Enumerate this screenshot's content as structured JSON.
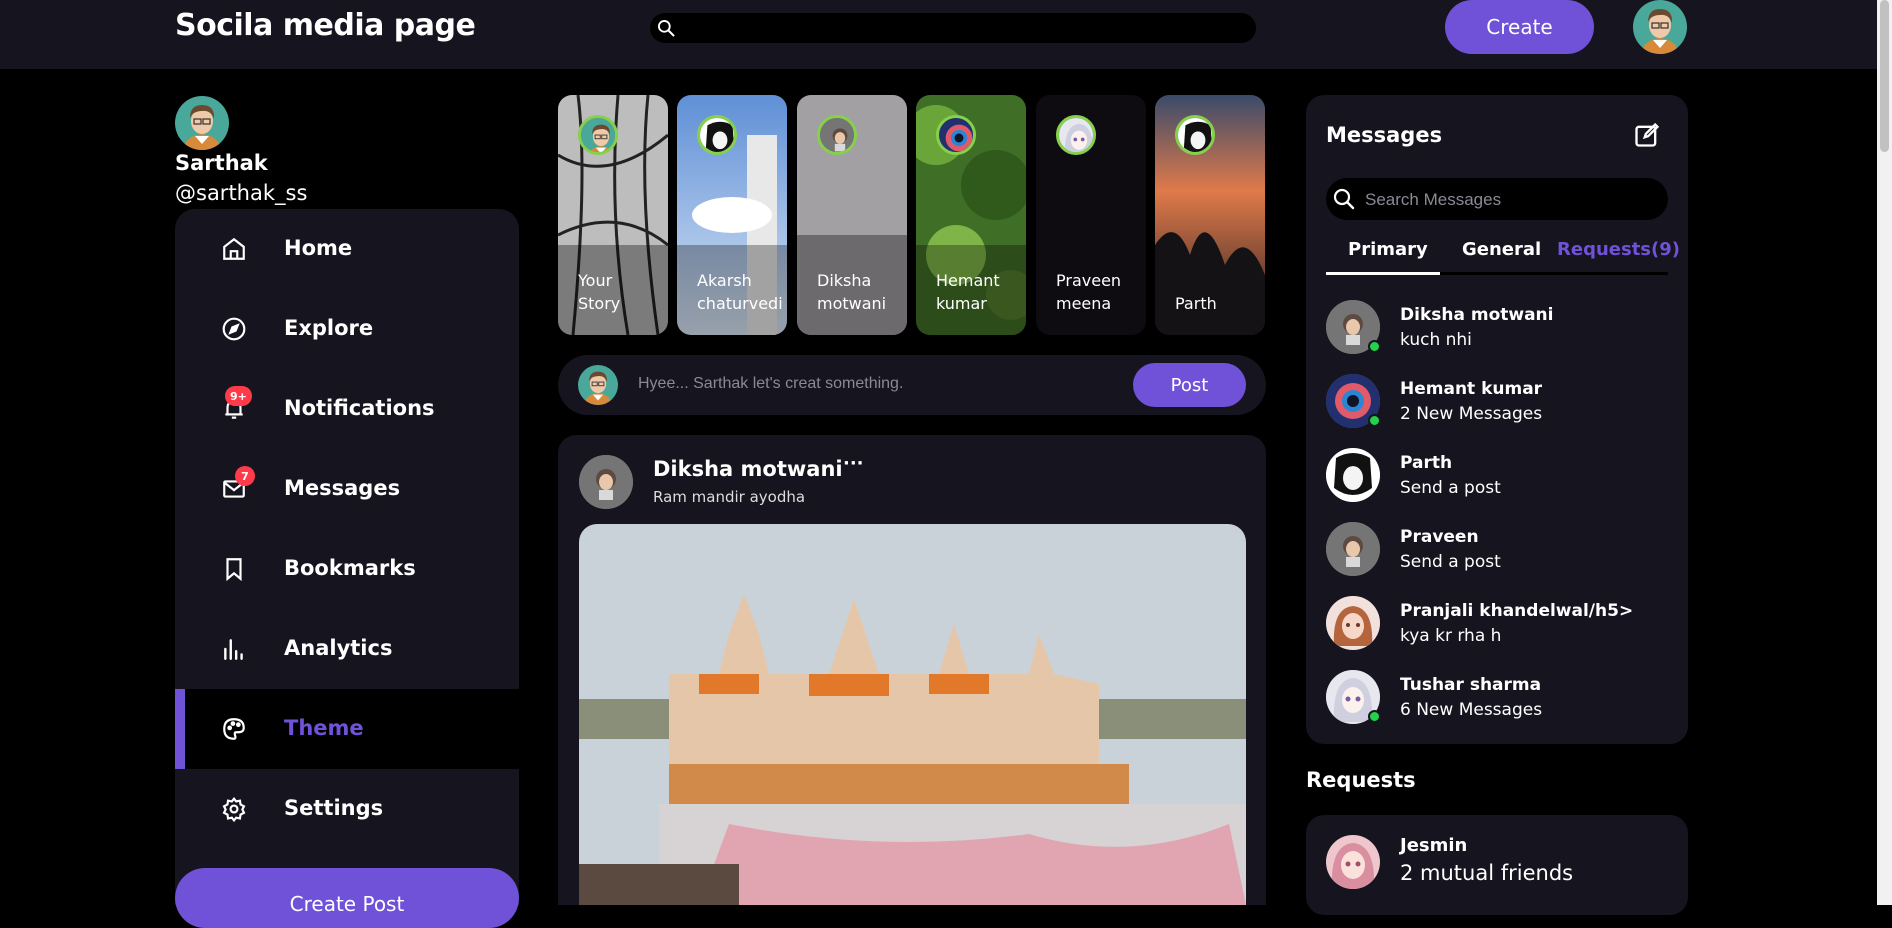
{
  "app": {
    "title": "Socila media page",
    "create_label": "Create"
  },
  "search": {
    "placeholder": ""
  },
  "profile": {
    "name": "Sarthak",
    "handle": "@sarthak_ss"
  },
  "sidebar": {
    "items": [
      {
        "label": "Home",
        "icon": "home-icon"
      },
      {
        "label": "Explore",
        "icon": "compass-icon"
      },
      {
        "label": "Notifications",
        "icon": "bell-icon",
        "badge": "9+"
      },
      {
        "label": "Messages",
        "icon": "mail-icon",
        "badge": "7"
      },
      {
        "label": "Bookmarks",
        "icon": "bookmark-icon"
      },
      {
        "label": "Analytics",
        "icon": "bar-chart-icon"
      },
      {
        "label": "Theme",
        "icon": "palette-icon",
        "active": true
      },
      {
        "label": "Settings",
        "icon": "gear-icon"
      }
    ],
    "create_post_label": "Create Post"
  },
  "stories": [
    {
      "line1": "Your",
      "line2": "Story"
    },
    {
      "line1": "Akarsh",
      "line2": "chaturvedi"
    },
    {
      "line1": "Diksha",
      "line2": "motwani"
    },
    {
      "line1": "Hemant",
      "line2": "kumar"
    },
    {
      "line1": "Praveen",
      "line2": "meena"
    },
    {
      "line1": "",
      "line2": "Parth"
    }
  ],
  "composer": {
    "placeholder": "Hyee... Sarthak let's creat something.",
    "post_label": "Post"
  },
  "feed": {
    "author": "Diksha motwani",
    "location": "Ram mandir ayodha",
    "more": "···"
  },
  "messages": {
    "title": "Messages",
    "search_placeholder": "Search Messages",
    "tabs": [
      "Primary",
      "General",
      "Requests(9)"
    ],
    "items": [
      {
        "name": "Diksha motwani",
        "text": "kuch nhi",
        "online": true
      },
      {
        "name": "Hemant kumar",
        "text": "2 New Messages",
        "online": true
      },
      {
        "name": "Parth",
        "text": "Send a post",
        "online": false
      },
      {
        "name": "Praveen",
        "text": "Send a post",
        "online": false
      },
      {
        "name": "Pranjali khandelwal/h5>",
        "text": "kya kr rha h",
        "online": false
      },
      {
        "name": "Tushar sharma",
        "text": "6 New Messages",
        "online": true
      }
    ]
  },
  "requests": {
    "title": "Requests",
    "name": "Jesmin",
    "text": "2 mutual friends"
  },
  "colors": {
    "accent": "#6f52d8",
    "panel": "#16141f",
    "online": "#23d24a",
    "badge": "#ff3b4a"
  }
}
